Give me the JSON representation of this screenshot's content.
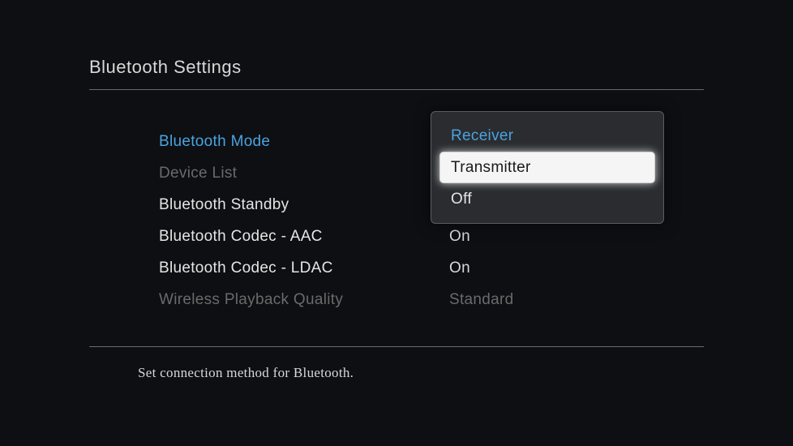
{
  "page_title": "Bluetooth Settings",
  "settings": [
    {
      "label": "Bluetooth Mode",
      "value": "Receiver",
      "state": "highlighted"
    },
    {
      "label": "Device List",
      "value": "",
      "state": "disabled"
    },
    {
      "label": "Bluetooth Standby",
      "value": "Off",
      "state": "normal"
    },
    {
      "label": "Bluetooth Codec - AAC",
      "value": "On",
      "state": "normal"
    },
    {
      "label": "Bluetooth Codec - LDAC",
      "value": "On",
      "state": "normal"
    },
    {
      "label": "Wireless Playback Quality",
      "value": "Standard",
      "state": "disabled"
    }
  ],
  "dropdown": {
    "options": [
      {
        "label": "Receiver",
        "state": "current"
      },
      {
        "label": "Transmitter",
        "state": "selected"
      },
      {
        "label": "Off",
        "state": "normal"
      }
    ]
  },
  "help_text": "Set connection method for Bluetooth."
}
